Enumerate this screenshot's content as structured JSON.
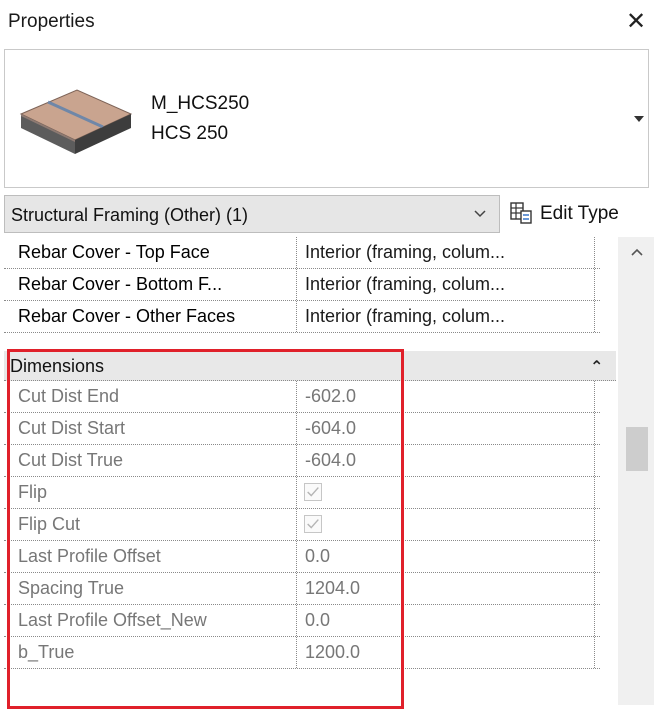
{
  "window": {
    "title": "Properties",
    "close_glyph": "✕"
  },
  "type_selector": {
    "family": "M_HCS250",
    "type": "HCS 250",
    "thumbnail_icon": "hollow-core-slab-icon",
    "dropdown_icon": "caret-down-icon"
  },
  "filter": {
    "selected": "Structural Framing (Other) (1)",
    "edit_type_label": "Edit Type",
    "edit_type_icon": "edit-type-icon"
  },
  "rows_top": [
    {
      "name": "Rebar Cover - Top Face",
      "value": "Interior (framing, colum..."
    },
    {
      "name": "Rebar Cover - Bottom F...",
      "value": "Interior (framing, colum..."
    },
    {
      "name": "Rebar Cover - Other Faces",
      "value": "Interior (framing, colum..."
    }
  ],
  "group": {
    "title": "Dimensions",
    "collapse_glyph": "⌃"
  },
  "dimension_rows": [
    {
      "name": "Cut Dist End",
      "value": "-602.0"
    },
    {
      "name": "Cut Dist Start",
      "value": "-604.0"
    },
    {
      "name": "Cut Dist True",
      "value": "-604.0"
    },
    {
      "name": "Flip",
      "value": "",
      "checkbox": true
    },
    {
      "name": "Flip Cut",
      "value": "",
      "checkbox": true
    },
    {
      "name": "Last Profile Offset",
      "value": "0.0"
    },
    {
      "name": "Spacing True",
      "value": "1204.0"
    },
    {
      "name": "Last Profile Offset_New",
      "value": "0.0"
    },
    {
      "name": "b_True",
      "value": "1200.0"
    }
  ],
  "colors": {
    "highlight": "#e0202a",
    "group_bg": "#e8e8e8",
    "greyed_text": "#777777"
  }
}
